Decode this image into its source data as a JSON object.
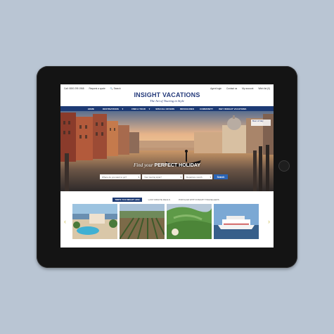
{
  "utility": {
    "call": "Call: 0800 295 1968",
    "brochure": "Request a quote",
    "search": "Search",
    "links": [
      "Agent login",
      "Contact us",
      "My account",
      "Wish list (0)"
    ]
  },
  "brand": {
    "name": "INSIGHT VACATIONS",
    "tagline": "The Art of Touring in Style"
  },
  "nav": [
    "HOME",
    "DESTINATIONS",
    "FIND A TOUR",
    "SPECIAL OFFERS",
    "BROCHURES",
    "COMMUNITY",
    "WHY INSIGHT VACATIONS"
  ],
  "hero": {
    "headline_lead": "Find your",
    "headline_strong": "PERFECT HOLIDAY",
    "badge_title": "Best of Italy",
    "search": {
      "destination_placeholder": "Where do you want to go?",
      "style_placeholder": "Your touring style?",
      "month_placeholder": "Departure month",
      "button": "Search"
    }
  },
  "tabs": [
    "TRIPS YOU MIGHT LIKE",
    "LAST MINUTE DEALS",
    "POPULAR WITH INSIGHT TRAVELLERS"
  ],
  "thumbnails": [
    "resort-coast",
    "vineyard",
    "green-valley",
    "river-cruise"
  ],
  "colors": {
    "brand_navy": "#1d3a74",
    "search_blue": "#2a64b6",
    "background": "#b9c5d3"
  }
}
